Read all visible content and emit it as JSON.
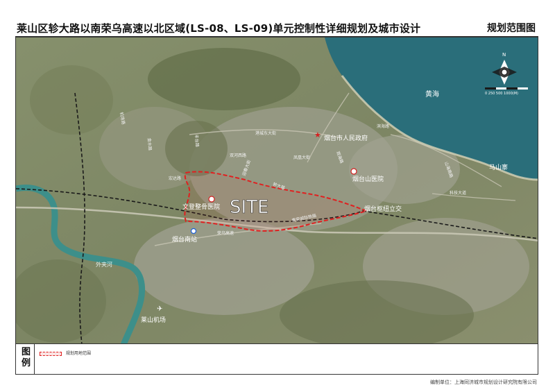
{
  "header": {
    "title": "莱山区轸大路以南荣乌高速以北区域(LS-08、LS-09)单元控制性详细规划及城市设计",
    "subtitle": "规划范围图"
  },
  "map": {
    "site_label": "SITE",
    "sea_label": "黄海",
    "river_label": "外夹河",
    "compass_label": "N",
    "scale_label": "0 250 500 1000(M)",
    "places": {
      "gov": "烟台市人民政府",
      "hospital_yts": "烟台山医院",
      "hospital_wd": "文登整骨医院",
      "junction": "烟台枢纽立交",
      "station": "烟台南站",
      "airport": "莱山机场",
      "mashan": "马山寨"
    },
    "roads": {
      "jichang": "机场路",
      "gangcheng": "港城东大街",
      "binhai": "滨海路",
      "fenghuang": "凤凰大街",
      "guanhai": "观海路",
      "shanhai": "山海南路",
      "keji": "科技大道",
      "rongwu": "荣乌高速",
      "qingrong": "青荣城际铁路",
      "zhenda": "轸大路",
      "shuanghe": "双河西路",
      "yingchun": "迎春大街",
      "fengtai": "丰台路",
      "jinshui": "金水路",
      "hongda": "宏达路"
    },
    "colors": {
      "sea": "#2a6e7a",
      "river": "#3d8f8a",
      "boundary": "#e02020",
      "land": "#7d8664"
    }
  },
  "legend": {
    "heading": "图例",
    "item": "规划用地范围"
  },
  "footer": {
    "credit": "编制单位：上海同济城市规划设计研究院有限公司"
  }
}
